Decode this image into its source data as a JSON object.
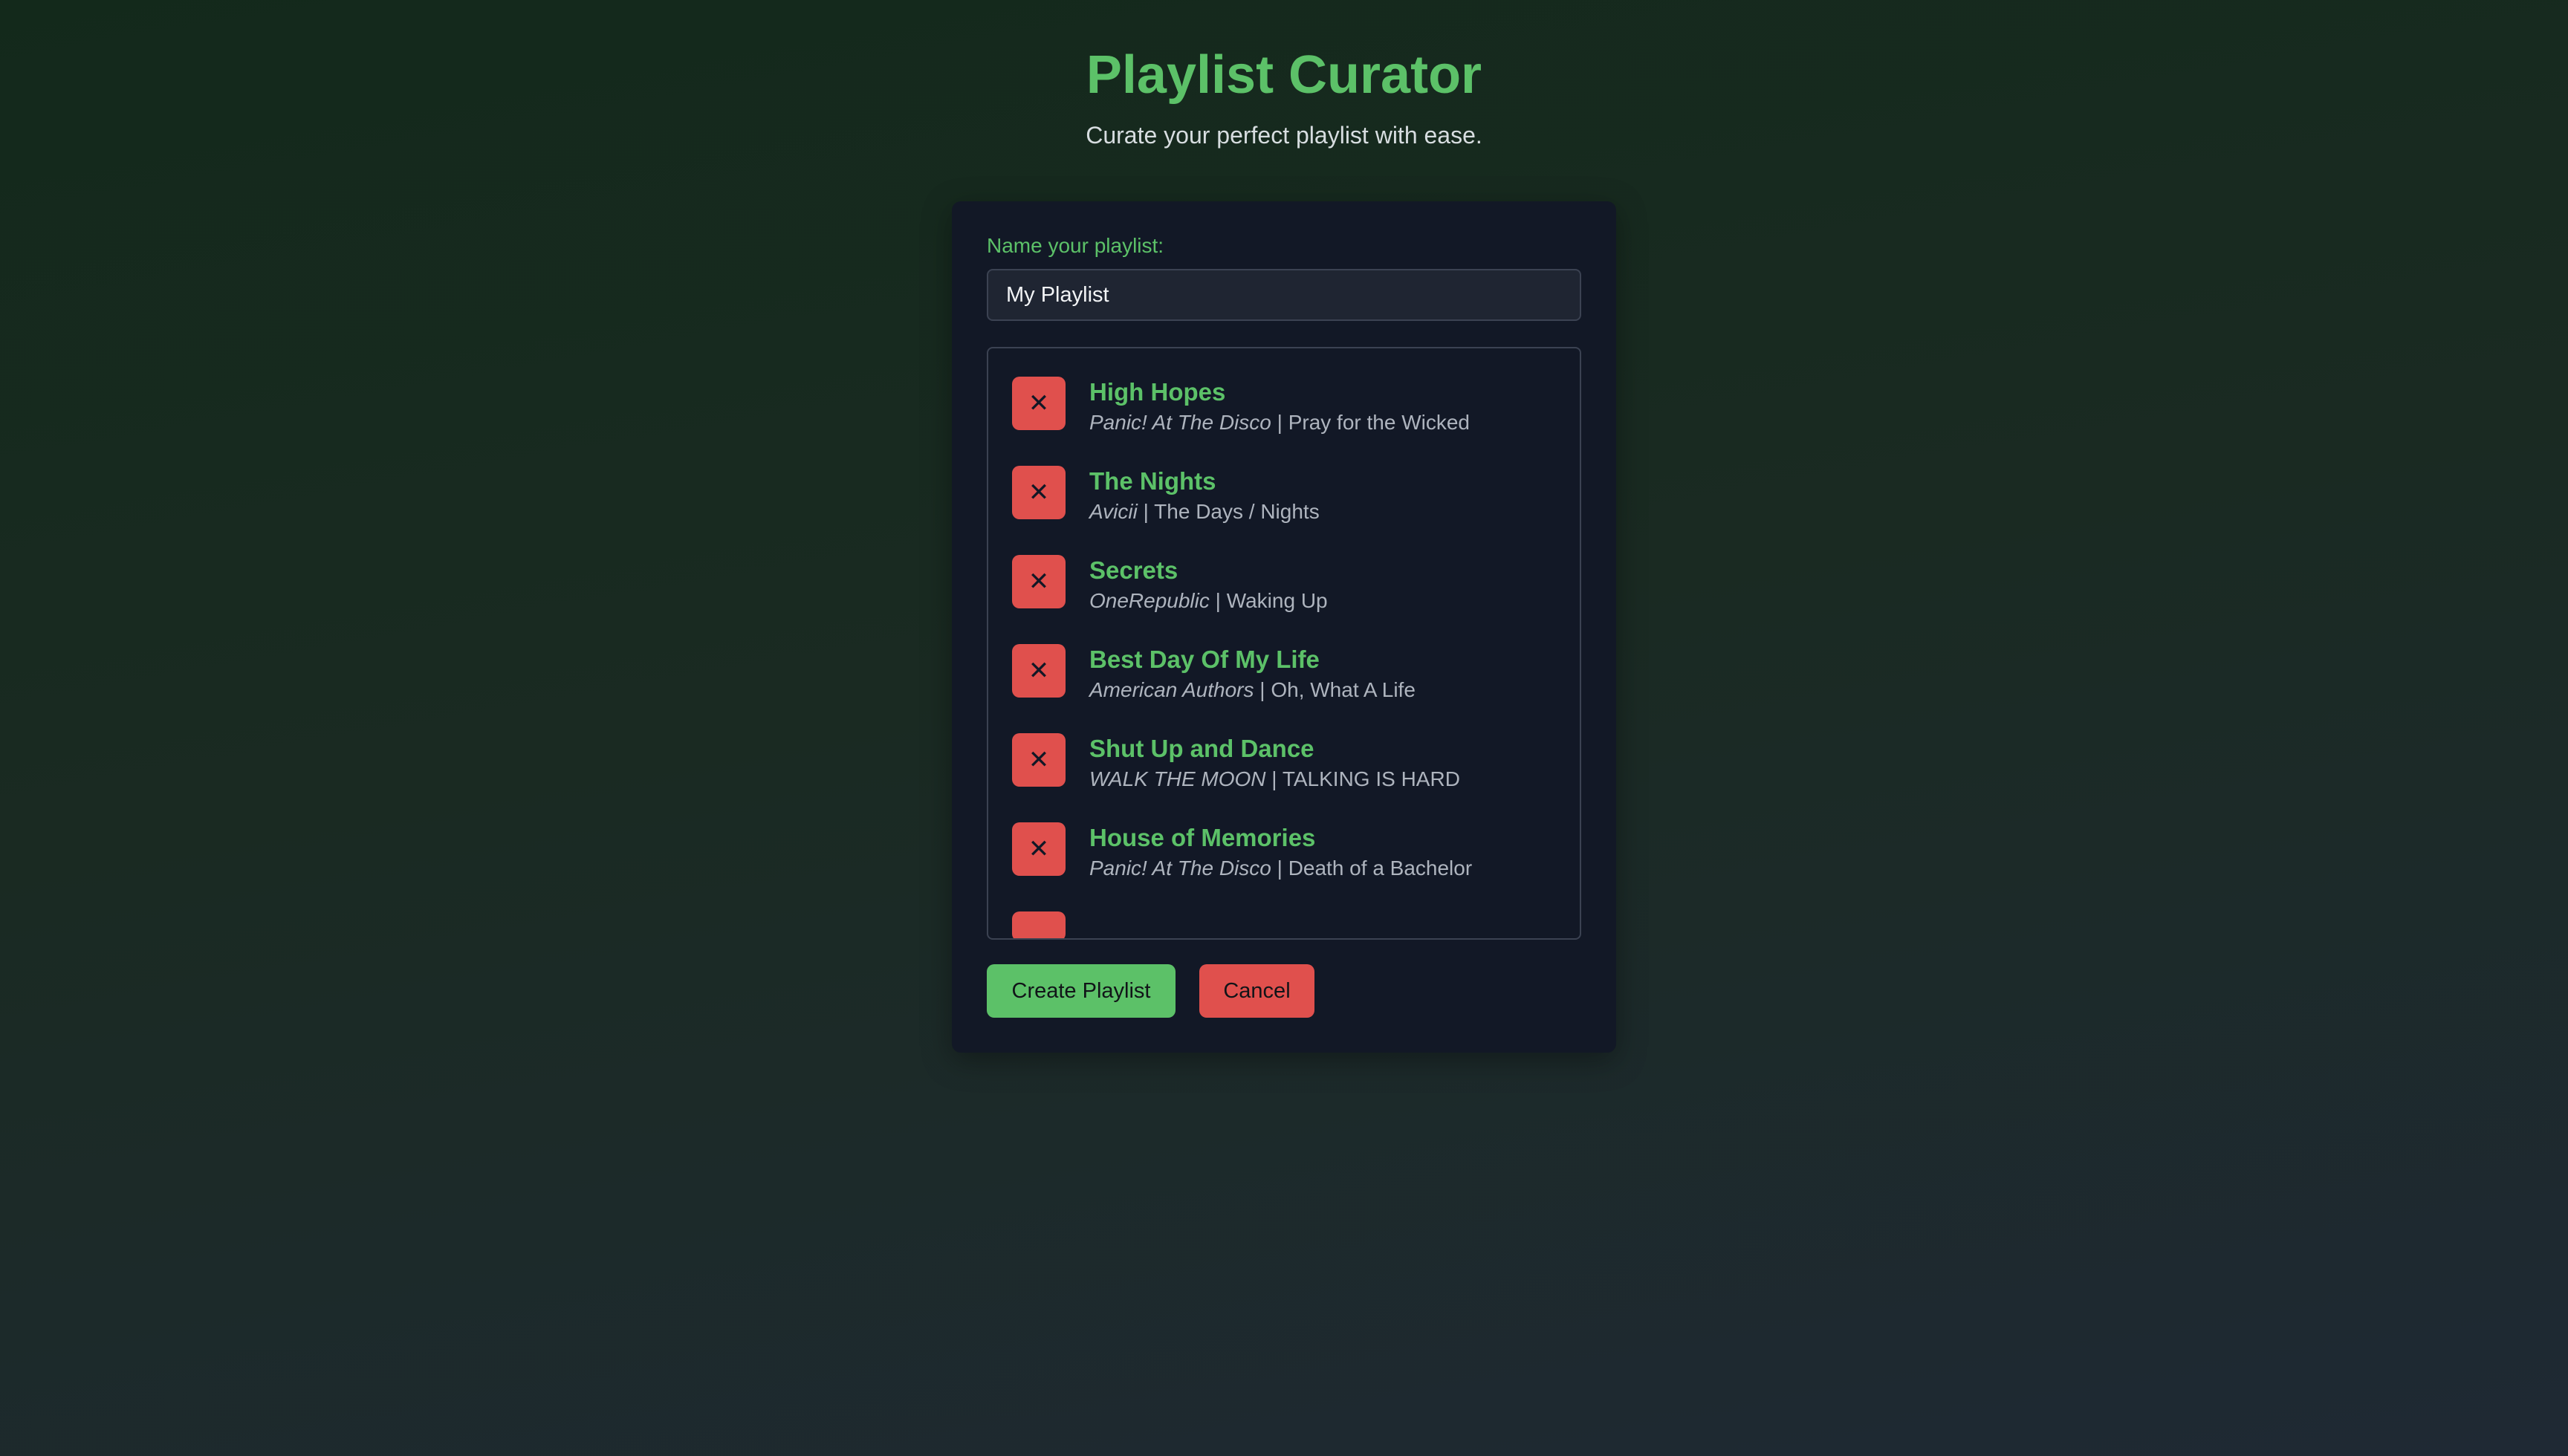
{
  "header": {
    "title": "Playlist Curator",
    "subtitle": "Curate your perfect playlist with ease."
  },
  "form": {
    "name_label": "Name your playlist:",
    "name_value": "My Playlist"
  },
  "songs": [
    {
      "title": "High Hopes",
      "artist": "Panic! At The Disco",
      "separator": " | ",
      "album": "Pray for the Wicked",
      "remove_icon": "close-icon",
      "remove_glyph": "✕"
    },
    {
      "title": "The Nights",
      "artist": "Avicii",
      "separator": " | ",
      "album": "The Days / Nights",
      "remove_icon": "close-icon",
      "remove_glyph": "✕"
    },
    {
      "title": "Secrets",
      "artist": "OneRepublic",
      "separator": " | ",
      "album": "Waking Up",
      "remove_icon": "close-icon",
      "remove_glyph": "✕"
    },
    {
      "title": "Best Day Of My Life",
      "artist": "American Authors",
      "separator": " | ",
      "album": "Oh, What A Life",
      "remove_icon": "close-icon",
      "remove_glyph": "✕"
    },
    {
      "title": "Shut Up and Dance",
      "artist": "WALK THE MOON",
      "separator": " | ",
      "album": "TALKING IS HARD",
      "remove_icon": "close-icon",
      "remove_glyph": "✕"
    },
    {
      "title": "House of Memories",
      "artist": "Panic! At The Disco",
      "separator": " | ",
      "album": "Death of a Bachelor",
      "remove_icon": "close-icon",
      "remove_glyph": "✕"
    }
  ],
  "actions": {
    "create_label": "Create Playlist",
    "cancel_label": "Cancel"
  },
  "colors": {
    "accent_green": "#5cc168",
    "danger_red": "#e0504d",
    "card_bg": "#121826"
  }
}
